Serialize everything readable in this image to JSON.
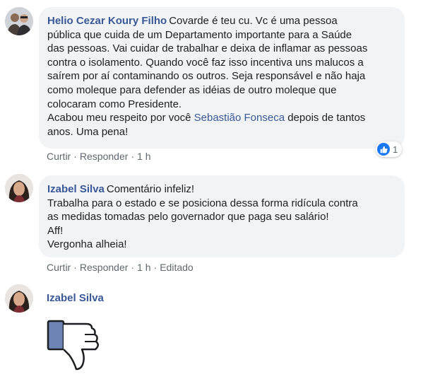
{
  "comments": [
    {
      "author": "Helio Cezar Koury Filho",
      "lines": [
        "Covarde é teu cu. Vc é uma pessoa",
        "pública que cuida de um Departamento importante para a Saúde",
        "das pessoas. Vai cuidar de trabalhar e deixa de inflamar as pessoas",
        "contra o isolamento. Quando você faz isso incentiva uns malucos a",
        "saírem por aí contaminando os outros. Seja responsável e não haja",
        "como moleque para defender as idéias de outro moleque que",
        "colocaram como Presidente."
      ],
      "line8_pre": "Acabou meu respeito por você ",
      "mention": "Sebastião Fonseca",
      "line8_post": " depois de tantos",
      "line9": "anos. Uma pena!",
      "actions": {
        "like": "Curtir",
        "reply": "Responder",
        "time": "1 h"
      },
      "reaction_count": "1"
    },
    {
      "author": "Izabel Silva",
      "lines": [
        "Comentário infeliz!",
        "Trabalha para o estado e se posiciona dessa forma ridícula contra",
        "as medidas tomadas pelo governador que paga seu salário!",
        "Aff!",
        "Vergonha alheia!"
      ],
      "actions": {
        "like": "Curtir",
        "reply": "Responder",
        "time": "1 h",
        "edited": "Editado"
      }
    },
    {
      "author": "Izabel Silva",
      "sticker_icon": "thumbs-down-icon"
    }
  ],
  "separator": "·",
  "colors": {
    "link": "#385898",
    "bubble": "#f2f3f5",
    "like": "#1877f2"
  }
}
